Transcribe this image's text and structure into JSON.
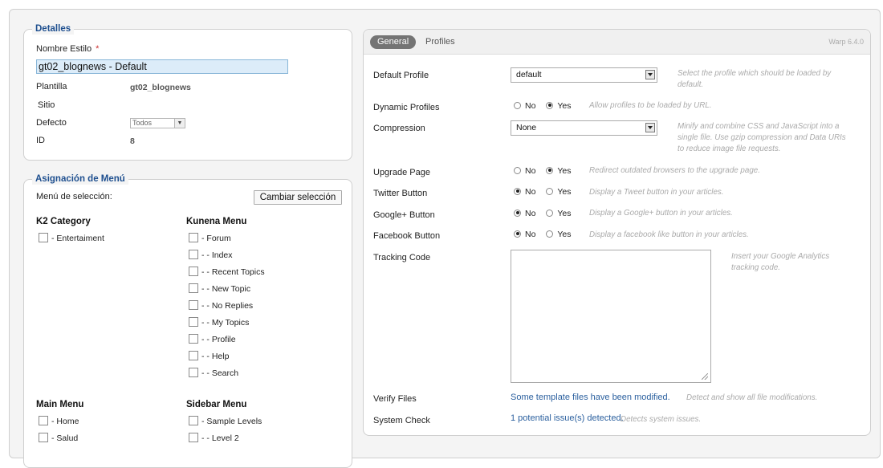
{
  "detalles": {
    "legend": "Detalles",
    "nombre_label": "Nombre Estilo",
    "required_mark": "*",
    "nombre_value": "gt02_blognews - Default",
    "plantilla_label": "Plantilla",
    "plantilla_value": "gt02_blognews",
    "sitio_label": "Sitio",
    "defecto_label": "Defecto",
    "defecto_value": "Todos",
    "id_label": "ID",
    "id_value": "8"
  },
  "menu": {
    "legend": "Asignación de Menú",
    "selection_label": "Menú de selección:",
    "change_button": "Cambiar selección",
    "groups": [
      {
        "title": "K2 Category",
        "items": [
          "- Entertaiment"
        ]
      },
      {
        "title": "Kunena Menu",
        "items": [
          "- Forum",
          "- - Index",
          "- - Recent Topics",
          "- - New Topic",
          "- - No Replies",
          "- - My Topics",
          "- - Profile",
          "- - Help",
          "- - Search"
        ]
      },
      {
        "title": "Main Menu",
        "items": [
          "- Home",
          "- Salud"
        ]
      },
      {
        "title": "Sidebar Menu",
        "items": [
          "- Sample Levels",
          "- - Level 2"
        ]
      }
    ]
  },
  "right": {
    "tabs": [
      "General",
      "Profiles"
    ],
    "version": "Warp 6.4.0",
    "default_profile": {
      "label": "Default Profile",
      "value": "default",
      "help": "Select the profile which should be loaded by default."
    },
    "dynamic_profiles": {
      "label": "Dynamic Profiles",
      "help": "Allow profiles to be loaded by URL."
    },
    "compression": {
      "label": "Compression",
      "value": "None",
      "help": "Minify and combine CSS and JavaScript into a single file. Use gzip compression and Data URIs to reduce image file requests."
    },
    "upgrade_page": {
      "label": "Upgrade Page",
      "help": "Redirect outdated browsers to the upgrade page."
    },
    "twitter": {
      "label": "Twitter Button",
      "help": "Display a Tweet button in your articles."
    },
    "googleplus": {
      "label": "Google+ Button",
      "help": "Display a Google+ button in your articles."
    },
    "facebook": {
      "label": "Facebook Button",
      "help": "Display a facebook like button in your articles."
    },
    "tracking": {
      "label": "Tracking Code",
      "help": "Insert your Google Analytics tracking code."
    },
    "verify": {
      "label": "Verify Files",
      "link": "Some template files have been modified.",
      "help": "Detect and show all file modifications."
    },
    "system": {
      "label": "System Check",
      "link": "1 potential issue(s) detected.",
      "help": "Detects system issues."
    },
    "radio_no": "No",
    "radio_yes": "Yes"
  }
}
